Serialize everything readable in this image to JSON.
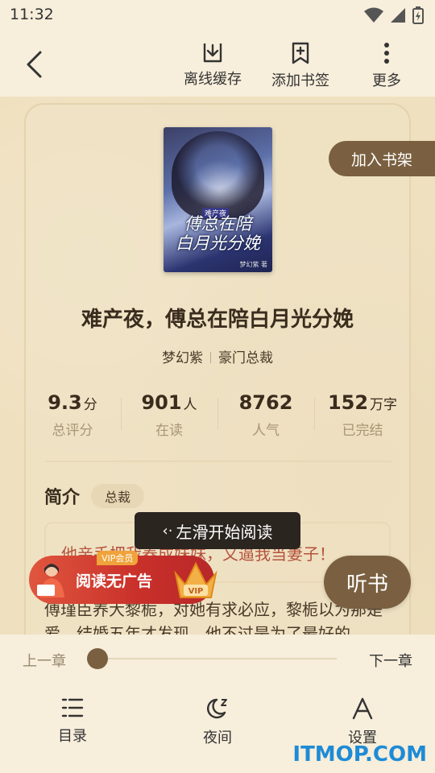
{
  "status_bar": {
    "time": "11:32"
  },
  "toolbar": {
    "offline_label": "离线缓存",
    "bookmark_label": "添加书签",
    "more_label": "更多"
  },
  "book": {
    "add_shelf_label": "加入书架",
    "cover_tag": "难产夜",
    "cover_title_line1": "傅总在陪",
    "cover_title_line2": "白月光分娩",
    "cover_author": "梦幻紫 著",
    "title": "难产夜，傅总在陪白月光分娩",
    "author": "梦幻紫",
    "category": "豪门总裁"
  },
  "stats": [
    {
      "num": "9.3",
      "unit": "分",
      "label": "总评分"
    },
    {
      "num": "901",
      "unit": "人",
      "label": "在读"
    },
    {
      "num": "8762",
      "unit": "",
      "label": "人气"
    },
    {
      "num": "152",
      "unit": "万字",
      "label": "已完结"
    }
  ],
  "intro": {
    "title": "简介",
    "tag": "总裁",
    "quote": "他亲手把我养成妹妹，又逼我当妻子！",
    "body": "傅瑾臣养大黎栀，对她有求必应，黎栀以为那是爱，结婚五年才发现，他不过是为了最好的"
  },
  "swipe_tip": "左滑开始阅读",
  "vip": {
    "tag": "VIP会员",
    "text": "阅读无广告"
  },
  "listen_label": "听书",
  "chapter": {
    "prev_label": "上一章",
    "next_label": "下一章",
    "progress": 0.0
  },
  "bottom_nav": {
    "toc_label": "目录",
    "night_label": "夜间",
    "settings_label": "设置"
  },
  "watermark": "ITMOP.COM",
  "colors": {
    "accent": "#7a6040",
    "background": "#f6ecd6",
    "quote": "#b5533e"
  }
}
